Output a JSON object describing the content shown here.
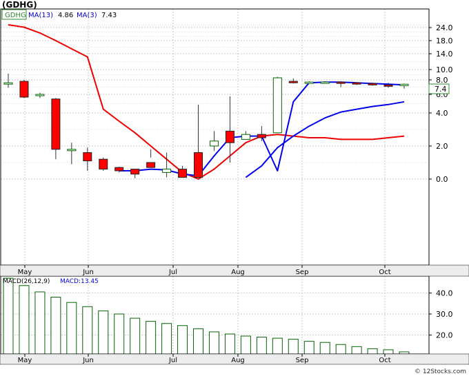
{
  "title": "(GDHG)",
  "watermark": "© 12Stocks.com",
  "legend": {
    "ticker_tag": "GDHG",
    "ma13_label": "MA(13)",
    "ma13_value": "4.86",
    "ma3_label": "MA(3)",
    "ma3_value": "7.43"
  },
  "last_price_tag": "7.4",
  "macd_legend": {
    "label": "MACD(26,12,9)",
    "value_label": "MACD:13.45"
  },
  "colors": {
    "bear": "#ff0000",
    "bull": "#ffffff",
    "wick": "#006400",
    "ma13": "#ee0000",
    "ma3": "#0000ee",
    "macd": "#006400",
    "grid": "#c8c8c8",
    "axis_bg": "#ececec"
  },
  "chart_data": [
    {
      "type": "candlestick",
      "name_hint": "price",
      "months": [
        "May",
        "Jun",
        "Jul",
        "Aug",
        "Sep",
        "Oct"
      ],
      "yticks": [
        {
          "label": "24.0",
          "v": 24.0
        },
        {
          "label": "18.0",
          "v": 18.0
        },
        {
          "label": "14.0",
          "v": 14.0
        },
        {
          "label": "10.0",
          "v": 10.0
        },
        {
          "label": "8.0",
          "v": 8.0
        },
        {
          "label": "6.0",
          "v": 6.0
        },
        {
          "label": "4.0",
          "v": 4.0
        },
        {
          "label": "2.0",
          "v": 2.0
        },
        {
          "label": "0.0",
          "v": 0.0
        }
      ],
      "candles": [
        {
          "o": 7.5,
          "h": 9.2,
          "l": 6.9,
          "c": 7.6
        },
        {
          "o": 7.8,
          "h": 8.0,
          "l": 5.6,
          "c": 5.7
        },
        {
          "o": 6.0,
          "h": 6.2,
          "l": 5.6,
          "c": 6.0
        },
        {
          "o": 5.5,
          "h": 5.6,
          "l": 1.2,
          "c": 1.8
        },
        {
          "o": 1.8,
          "h": 2.2,
          "l": 0.9,
          "c": 1.8
        },
        {
          "o": 1.6,
          "h": 1.9,
          "l": 0.5,
          "c": 1.1
        },
        {
          "o": 1.2,
          "h": 1.3,
          "l": 0.5,
          "c": 0.6
        },
        {
          "o": 0.7,
          "h": 0.75,
          "l": 0.4,
          "c": 0.5
        },
        {
          "o": 0.6,
          "h": 0.6,
          "l": 0.05,
          "c": 0.3
        },
        {
          "o": 1.0,
          "h": 1.3,
          "l": -1.8,
          "c": 0.7
        },
        {
          "o": 0.4,
          "h": 1.6,
          "l": 0.1,
          "c": 0.6
        },
        {
          "o": 0.6,
          "h": 0.8,
          "l": -0.4,
          "c": -0.1
        },
        {
          "o": -0.1,
          "h": -0.1,
          "l": -4.5,
          "c": -1.6
        },
        {
          "o": -2.3,
          "h": -1.7,
          "l": -2.9,
          "c": -2.0
        },
        {
          "o": -2.2,
          "h": -1.0,
          "l": -5.0,
          "c": -2.9
        },
        {
          "o": -2.7,
          "h": -2.4,
          "l": -2.9,
          "c": -2.4
        },
        {
          "o": -2.5,
          "h": -2.3,
          "l": -3.2,
          "c": -2.7
        },
        {
          "o": -2.8,
          "h": 8.6,
          "l": -3.1,
          "c": 8.4
        },
        {
          "o": 7.8,
          "h": 8.3,
          "l": 7.5,
          "c": 7.6
        },
        {
          "o": 7.6,
          "h": 7.8,
          "l": 7.5,
          "c": 7.7
        },
        {
          "o": 7.6,
          "h": 7.8,
          "l": 7.5,
          "c": 7.7
        },
        {
          "o": 7.7,
          "h": 7.8,
          "l": 7.0,
          "c": 7.6
        },
        {
          "o": 7.6,
          "h": 7.7,
          "l": 7.3,
          "c": 7.5
        },
        {
          "o": 7.5,
          "h": 7.6,
          "l": 7.2,
          "c": 7.3
        },
        {
          "o": 7.3,
          "h": 7.6,
          "l": 6.9,
          "c": 7.2
        },
        {
          "o": 7.2,
          "h": 7.5,
          "l": 6.8,
          "c": 7.4
        }
      ],
      "ma13": [
        28.0,
        24.5,
        21.5,
        18.0,
        15.5,
        13.2,
        4.4,
        3.5,
        2.8,
        2.0,
        1.2,
        0.4,
        0.0,
        -0.6,
        -1.4,
        -2.2,
        -2.6,
        -2.7,
        -2.6,
        -2.5,
        -2.5,
        -2.4,
        -2.4,
        -2.4,
        -2.5,
        -2.6
      ],
      "ma13_segment_y": [
        14.0,
        10.0,
        5.0,
        4.4,
        3.5,
        2.8,
        2.0,
        1.2,
        0.4,
        0.0,
        -0.6,
        -1.4,
        -2.2,
        -2.6,
        -2.7,
        -2.6,
        -2.5,
        -2.5,
        -2.4
      ],
      "ma3": [
        null,
        null,
        null,
        null,
        null,
        null,
        null,
        0.5,
        0.5,
        0.6,
        0.55,
        0.3,
        -0.2,
        -1.4,
        -2.5,
        -2.6,
        -2.6,
        0.5,
        5.2,
        7.6,
        7.7,
        7.7,
        7.6,
        7.5,
        7.4,
        7.3
      ],
      "ma13_tail": [
        null,
        null,
        null,
        null,
        null,
        null,
        null,
        null,
        null,
        null,
        null,
        null,
        null,
        null,
        null,
        -0.1,
        0.8,
        1.9,
        2.6,
        3.2,
        3.7,
        4.1,
        4.4,
        4.7,
        4.9,
        5.2
      ]
    },
    {
      "type": "bar",
      "name_hint": "macd",
      "months": [
        "May",
        "Jun",
        "Jul",
        "Aug",
        "Sep",
        "Oct"
      ],
      "yticks": [
        {
          "label": "40.0",
          "v": 40.0
        },
        {
          "label": "30.0",
          "v": 30.0
        },
        {
          "label": "20.0",
          "v": 20.0
        }
      ],
      "ylim": [
        11,
        48
      ],
      "values": [
        47.0,
        43.5,
        40.5,
        38.0,
        35.5,
        33.5,
        31.5,
        30.0,
        28.0,
        26.5,
        25.5,
        24.5,
        23.0,
        21.5,
        20.5,
        19.5,
        19.0,
        18.5,
        18.0,
        17.0,
        16.5,
        15.5,
        14.5,
        13.5,
        13.0,
        12.0
      ]
    }
  ]
}
